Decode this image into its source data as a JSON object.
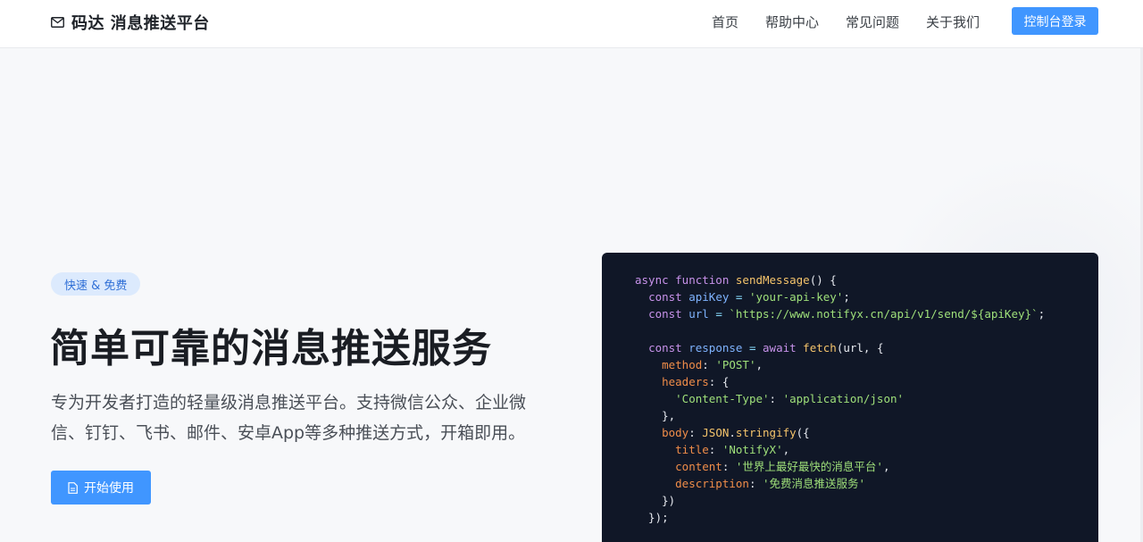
{
  "brand": {
    "icon": "mail-icon",
    "title": "码达 消息推送平台"
  },
  "nav": {
    "links": [
      "首页",
      "帮助中心",
      "常见问题",
      "关于我们"
    ],
    "login_label": "控制台登录"
  },
  "hero": {
    "badge": "快速 & 免费",
    "title": "简单可靠的消息推送服务",
    "description": "专为开发者打造的轻量级消息推送平台。支持微信公众、企业微信、钉钉、飞书、邮件、安卓App等多种推送方式，开箱即用。",
    "start_button": {
      "icon": "document-icon",
      "label": "开始使用"
    }
  },
  "code": {
    "lines": [
      [
        [
          "kw",
          "async "
        ],
        [
          "kw",
          "function "
        ],
        [
          "fn",
          "sendMessage"
        ],
        [
          "p",
          "() {"
        ]
      ],
      [
        [
          "p",
          "  "
        ],
        [
          "kw",
          "const "
        ],
        [
          "var",
          "apiKey"
        ],
        [
          "op",
          " = "
        ],
        [
          "str",
          "'your-api-key'"
        ],
        [
          "p",
          ";"
        ]
      ],
      [
        [
          "p",
          "  "
        ],
        [
          "kw",
          "const "
        ],
        [
          "var",
          "url"
        ],
        [
          "op",
          " = "
        ],
        [
          "str",
          "`https://www.notifyx.cn/api/v1/send/${apiKey}`"
        ],
        [
          "p",
          ";"
        ]
      ],
      [
        [
          "p",
          ""
        ]
      ],
      [
        [
          "p",
          "  "
        ],
        [
          "kw",
          "const "
        ],
        [
          "var",
          "response"
        ],
        [
          "op",
          " = "
        ],
        [
          "kw",
          "await "
        ],
        [
          "fn",
          "fetch"
        ],
        [
          "p",
          "(url, {"
        ]
      ],
      [
        [
          "p",
          "    "
        ],
        [
          "prop",
          "method"
        ],
        [
          "p",
          ": "
        ],
        [
          "str",
          "'POST'"
        ],
        [
          "p",
          ","
        ]
      ],
      [
        [
          "p",
          "    "
        ],
        [
          "prop",
          "headers"
        ],
        [
          "p",
          ": {"
        ]
      ],
      [
        [
          "p",
          "      "
        ],
        [
          "str",
          "'Content-Type'"
        ],
        [
          "p",
          ": "
        ],
        [
          "str",
          "'application/json'"
        ]
      ],
      [
        [
          "p",
          "    },"
        ]
      ],
      [
        [
          "p",
          "    "
        ],
        [
          "prop",
          "body"
        ],
        [
          "p",
          ": "
        ],
        [
          "obj",
          "JSON"
        ],
        [
          "p",
          "."
        ],
        [
          "fn",
          "stringify"
        ],
        [
          "p",
          "({"
        ]
      ],
      [
        [
          "p",
          "      "
        ],
        [
          "prop",
          "title"
        ],
        [
          "p",
          ": "
        ],
        [
          "str",
          "'NotifyX'"
        ],
        [
          "p",
          ","
        ]
      ],
      [
        [
          "p",
          "      "
        ],
        [
          "prop",
          "content"
        ],
        [
          "p",
          ": "
        ],
        [
          "str",
          "'世界上最好最快的消息平台'"
        ],
        [
          "p",
          ","
        ]
      ],
      [
        [
          "p",
          "      "
        ],
        [
          "prop",
          "description"
        ],
        [
          "p",
          ": "
        ],
        [
          "str",
          "'免费消息推送服务'"
        ]
      ],
      [
        [
          "p",
          "    })"
        ]
      ],
      [
        [
          "p",
          "  });"
        ]
      ]
    ]
  },
  "colors": {
    "accent": "#4096ff",
    "badge_bg": "#dceafd",
    "code_bg": "#101727"
  }
}
